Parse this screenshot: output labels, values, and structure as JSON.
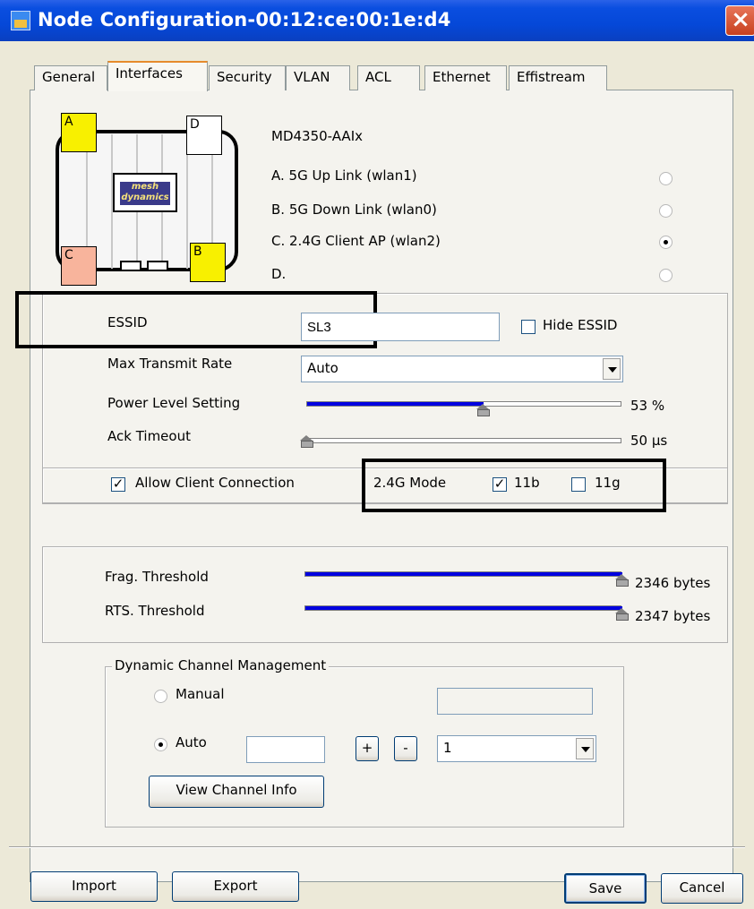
{
  "window": {
    "title": "Node Configuration-00:12:ce:00:1e:d4",
    "close_label": "×",
    "app_icon": "app-window-icon"
  },
  "tabs": [
    {
      "label": "General",
      "active": false
    },
    {
      "label": "Interfaces",
      "active": true
    },
    {
      "label": "Security",
      "active": false
    },
    {
      "label": "VLAN",
      "active": false
    },
    {
      "label": "ACL",
      "active": false
    },
    {
      "label": "Ethernet",
      "active": false
    },
    {
      "label": "Effistream",
      "active": false
    }
  ],
  "node": {
    "model": "MD4350-AAIx",
    "logo_line1": "mesh",
    "logo_line2": "dynamics",
    "antennas": [
      "A",
      "B",
      "C",
      "D"
    ],
    "antenna_colors": {
      "A": "#F8F000",
      "B": "#F8F000",
      "C": "#F8B49C",
      "D": "#FFFFFF"
    },
    "interfaces": [
      {
        "label": "A. 5G  Up Link (wlan1)",
        "selected": false
      },
      {
        "label": "B. 5G  Down Link (wlan0)",
        "selected": false
      },
      {
        "label": "C. 2.4G  Client AP (wlan2)",
        "selected": true
      },
      {
        "label": "D.",
        "selected": false
      }
    ]
  },
  "settings": {
    "essid_label": "ESSID",
    "essid_value": "SL3",
    "hide_essid_label": "Hide ESSID",
    "hide_essid_checked": false,
    "max_rate_label": "Max Transmit Rate",
    "max_rate_value": "Auto",
    "power_label": "Power Level Setting",
    "power_value": "53 %",
    "power_percent": 53,
    "ack_label": "Ack Timeout",
    "ack_value": "50 µs",
    "ack_fraction": 0
  },
  "client": {
    "allow_label": "Allow Client Connection",
    "allow_checked": true,
    "mode_label": "2.4G Mode",
    "mode_11b_label": "11b",
    "mode_11b_checked": true,
    "mode_11g_label": "11g",
    "mode_11g_checked": false
  },
  "thresholds": {
    "frag_label": "Frag. Threshold",
    "frag_value": "2346 bytes",
    "frag_fraction": 1,
    "rts_label": "RTS. Threshold",
    "rts_value": "2347 bytes",
    "rts_fraction": 1
  },
  "dcm": {
    "group_label": "Dynamic Channel Management",
    "manual_label": "Manual",
    "manual_selected": false,
    "manual_value": "",
    "auto_label": "Auto",
    "auto_selected": true,
    "auto_value": "",
    "plus_label": "+",
    "minus_label": "-",
    "channel_value": "1",
    "view_info_label": "View Channel Info"
  },
  "footer": {
    "import_label": "Import",
    "export_label": "Export",
    "save_label": "Save",
    "cancel_label": "Cancel"
  },
  "colors": {
    "titlebar": "#0548D8",
    "slider_fill": "#0000E0",
    "window_bg": "#ECE9D8",
    "active_tab_accent": "#E68B2C"
  }
}
